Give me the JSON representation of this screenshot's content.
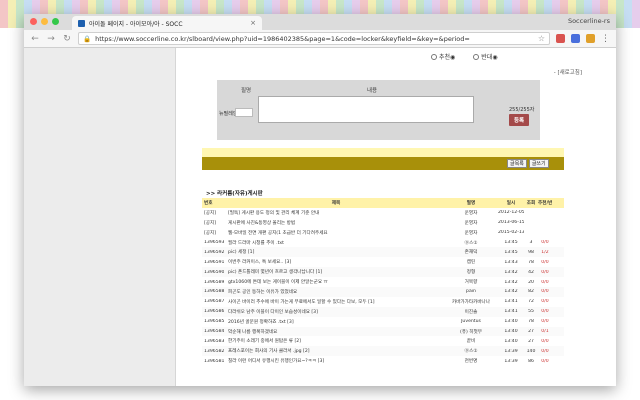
{
  "browser": {
    "tab_title": "아이돌 페이지 - 아이모아/아 - SOCC",
    "tab_close": "×",
    "user_name": "Soccerline-rs",
    "url": "https://www.soccerline.co.kr/slboard/view.php?uid=1986402385&page=1&code=locker&keyfield=&key=&period=",
    "lock_icon": "lock-icon",
    "back": "←",
    "forward": "→",
    "reload": "↻",
    "star": "☆",
    "menu": "⋮"
  },
  "vote": {
    "up_label": "추천◉",
    "down_label": "반대◉"
  },
  "refresh_link": "- [새로고침]",
  "comment_form": {
    "col_name": "필명",
    "col_content": "내용",
    "name_label": "뉴필레인",
    "char_count": "255/255자",
    "submit_label": "등록"
  },
  "buttons": {
    "list": "글목록",
    "write": "글쓰기"
  },
  "section_title": ">> 라커룸(자유)게시판",
  "table": {
    "headers": {
      "no": "번호",
      "title": "제목",
      "author": "필명",
      "date": "일시",
      "views": "조회",
      "rec": "추천/반추"
    },
    "rows": [
      {
        "no": "[공지]",
        "title": "[필독] 게시판 용도 정의 및 관리 체계 기준 안내",
        "author": "운영자",
        "date": "2012-12-05",
        "views": "",
        "rec": ""
      },
      {
        "no": "[공지]",
        "title": "게시판에 사진&동영상 올리는 방법",
        "author": "운영자",
        "date": "2013-06-15",
        "views": "",
        "rec": ""
      },
      {
        "no": "[공지]",
        "title": "웹-모바일 전면 개편 공지(1 초급반 더 기다려주세요",
        "author": "운영자",
        "date": "2015-02-13",
        "views": "",
        "rec": ""
      },
      {
        "no": "1396593",
        "title": "필라 드라마 시청률 추이 .txt",
        "author": "⓪스①",
        "date": "13:45",
        "views": "3",
        "rec": "0/0"
      },
      {
        "no": "1396592",
        "title": "pic) 세정 [1]",
        "author": "존재덕",
        "date": "13:45",
        "views": "98",
        "rec": "1/2"
      },
      {
        "no": "1396591",
        "title": "이번주 라커이스, 특 보세요.. [3]",
        "author": "캡틴",
        "date": "13:43",
        "views": "78",
        "rec": "0/0"
      },
      {
        "no": "1396590",
        "title": "pic) 폰드톨레미 몇년이 흐르고 생각나납니다 [1]",
        "author": "정형",
        "date": "13:42",
        "views": "42",
        "rec": "0/0"
      },
      {
        "no": "1396589",
        "title": "gtx1060에 튼데 보는 게이블이 이제 안알는군요 ㅠ",
        "author": "거북향",
        "date": "13:42",
        "views": "20",
        "rec": "0/0"
      },
      {
        "no": "1396588",
        "title": "피곤도 공인 동하는 이유가 있었네요",
        "author": "pain",
        "date": "13:42",
        "views": "82",
        "rec": "0/0"
      },
      {
        "no": "1396587",
        "title": "사이곤 바이러 추수에 바이 가는게 무료에서도 일할 수 있다는 다보, 모두 [1]",
        "author": "카바가가타카바나나",
        "date": "13:41",
        "views": "72",
        "rec": "0/0"
      },
      {
        "no": "1396586",
        "title": "다라쉬오 남주 이블이 다이인 보습성이네요 [3]",
        "author": "이진솔",
        "date": "13:41",
        "views": "55",
        "rec": "0/0"
      },
      {
        "no": "1396585",
        "title": "2016년 골문원 정확하죠 .txt [3]",
        "author": "Juventus",
        "date": "13:40",
        "views": "78",
        "rec": "0/0"
      },
      {
        "no": "1396584",
        "title": "악순해 나름 행복하겠네요",
        "author": "(퓨) 히첫무",
        "date": "13:40",
        "views": "27",
        "rec": "0/1"
      },
      {
        "no": "1396583",
        "title": "한기주이 소래기 중에서 원탑은 류 [2]",
        "author": "끝비",
        "date": "13:40",
        "views": "27",
        "rec": "0/0"
      },
      {
        "no": "1396582",
        "title": "프레스포이는 회사의 기사 클라서 .jpg [2]",
        "author": "⓪스①",
        "date": "13:39",
        "views": "140",
        "rec": "0/0"
      },
      {
        "no": "1396581",
        "title": "칠라 이런 어디서 유행시킨 유행인가요~?ㅋㅋ [3]",
        "author": "천번명",
        "date": "13:39",
        "views": "86",
        "rec": "0/0"
      }
    ]
  }
}
